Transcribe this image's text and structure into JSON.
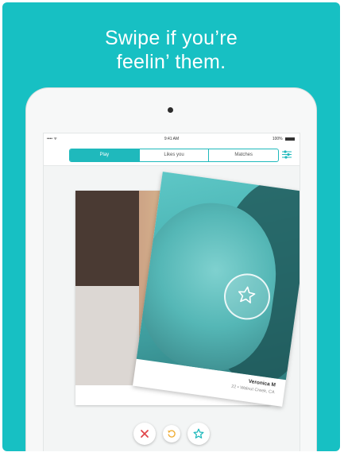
{
  "headline": {
    "line1": "Swipe if you’re",
    "line2": "feelin’ them."
  },
  "status_bar": {
    "carrier": "•••• ᯤ",
    "time": "9:41 AM",
    "battery": "100%"
  },
  "tabs": [
    {
      "label": "Play",
      "active": true
    },
    {
      "label": "Likes you",
      "active": false
    },
    {
      "label": "Matches",
      "active": false
    }
  ],
  "card": {
    "name": "Veronica M",
    "location": "22 • Walnut Creek, CA"
  },
  "colors": {
    "brand": "#17c0c3",
    "accent": "#1fb9bc",
    "pass": "#e0464b",
    "rewind": "#f0b03a",
    "like": "#1fb9bc"
  },
  "icons": {
    "filter": "sliders-icon",
    "star": "star-icon",
    "pass": "x-icon",
    "rewind": "rewind-icon",
    "like": "star-icon"
  }
}
